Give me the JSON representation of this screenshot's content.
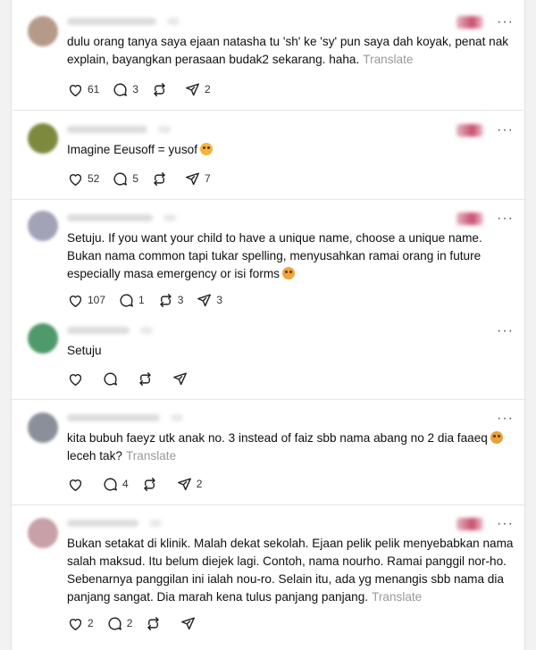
{
  "translate_label": "Translate",
  "more_label": "···",
  "posts": [
    {
      "avatar_color": "#b59a8a",
      "text": "dulu orang tanya saya ejaan natasha tu 'sh' ke 'sy' pun saya dah koyak, penat nak explain, bayangkan perasaan budak2 sekarang. haha.",
      "emoji_color": "",
      "show_translate": true,
      "likes": "61",
      "replies": "3",
      "reposts": "",
      "shares": "2"
    },
    {
      "avatar_color": "#7d8a3e",
      "text": "Imagine Eeusoff = yusof",
      "emoji_color": "#f6b33c",
      "show_translate": false,
      "likes": "52",
      "replies": "5",
      "reposts": "",
      "shares": "7"
    },
    {
      "avatar_color": "#a3a3b8",
      "text": "Setuju. If you want your child to have a unique name, choose a unique name. Bukan nama common tapi tukar spelling, menyusahkan ramai orang in future especially masa emergency or isi forms",
      "emoji_color": "#f2a33a",
      "show_translate": false,
      "likes": "107",
      "replies": "1",
      "reposts": "3",
      "shares": "3"
    },
    {
      "avatar_color": "#4f9a6a",
      "text": "Setuju",
      "emoji_color": "",
      "show_translate": false,
      "likes": "",
      "replies": "",
      "reposts": "",
      "shares": ""
    },
    {
      "avatar_color": "#8a8f99",
      "text": "kita bubuh faeyz utk anak no. 3 instead of faiz sbb nama abang no 2 dia faaeq",
      "text_tail": "leceh tak?",
      "emoji_color": "#e8a03a",
      "show_translate": true,
      "likes": "",
      "replies": "4",
      "reposts": "",
      "shares": "2"
    },
    {
      "avatar_color": "#c8a0a8",
      "text": "Bukan setakat di klinik. Malah dekat sekolah. Ejaan pelik pelik menyebabkan nama salah maksud. Itu belum diejek lagi. Contoh, nama nourho. Ramai panggil nor-ho. Sebenarnya panggilan ini ialah nou-ro. Selain itu, ada yg menangis sbb nama dia panjang sangat. Dia marah kena tulus panjang panjang.",
      "emoji_color": "",
      "show_translate": true,
      "likes": "2",
      "replies": "2",
      "reposts": "",
      "shares": ""
    }
  ]
}
